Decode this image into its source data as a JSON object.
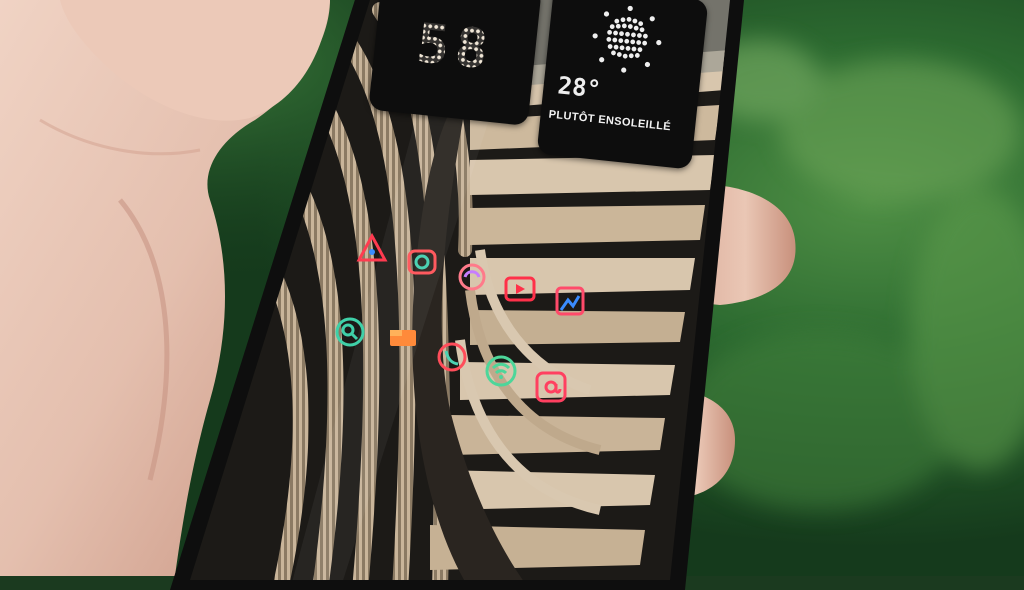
{
  "widgets": {
    "clock": {
      "time_upper_partial": "",
      "time_lower": "58"
    },
    "weather": {
      "temperature": "28°",
      "condition": "PLUTÔT ENSOLEILLÉ",
      "icon": "sun-icon"
    }
  },
  "home_icons": [
    {
      "name": "shortcut-icon",
      "color": "#ff3b50"
    },
    {
      "name": "camera-icon",
      "color": "#ff5a5f"
    },
    {
      "name": "sync-icon",
      "color": "#ff7a8a"
    },
    {
      "name": "video-icon",
      "color": "#ff3049"
    },
    {
      "name": "photos-icon",
      "color": "#ff4a6a"
    },
    {
      "name": "search-icon",
      "color": "#3fd0a8"
    },
    {
      "name": "folder-icon",
      "color": "#ff8a3a"
    },
    {
      "name": "phone-icon",
      "color": "#ff4d5a"
    },
    {
      "name": "wifi-icon",
      "color": "#4dd69a"
    },
    {
      "name": "at-sign-icon",
      "color": "#ff4060"
    }
  ],
  "colors": {
    "foliage": "#2f6b32",
    "skin": "#e8c8b8",
    "phone_frame": "#111111",
    "building_light": "#d9c8b0",
    "building_dark": "#1c1a17"
  }
}
